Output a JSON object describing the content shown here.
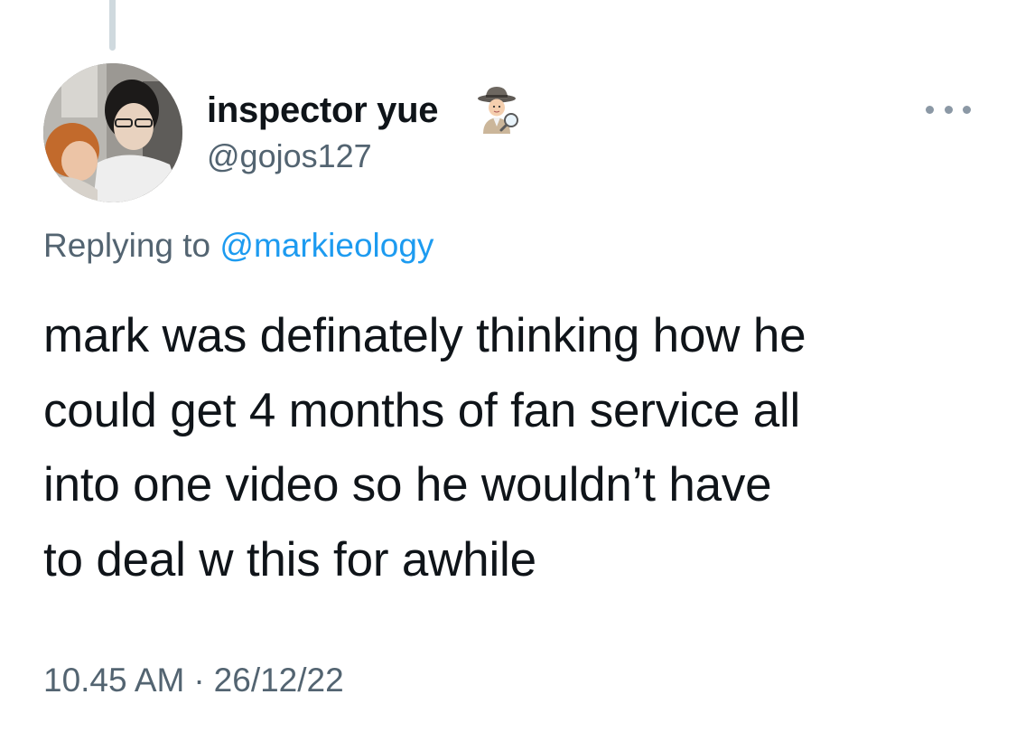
{
  "tweet": {
    "display_name": "inspector yue",
    "name_emoji": "detective-icon",
    "handle": "@gojos127",
    "replying_prefix": "Replying to",
    "replying_to": "@markieology",
    "text_lines": [
      "mark was definately thinking how he",
      "could get 4 months of fan service all",
      "into one video so he wouldn’t have",
      "to deal w this for awhile"
    ],
    "time": "10.45 AM",
    "separator": "·",
    "date": "26/12/22"
  },
  "colors": {
    "text": "#0f1419",
    "secondary": "#536471",
    "link": "#1d9bf0",
    "thread_line": "#cfd9de"
  }
}
